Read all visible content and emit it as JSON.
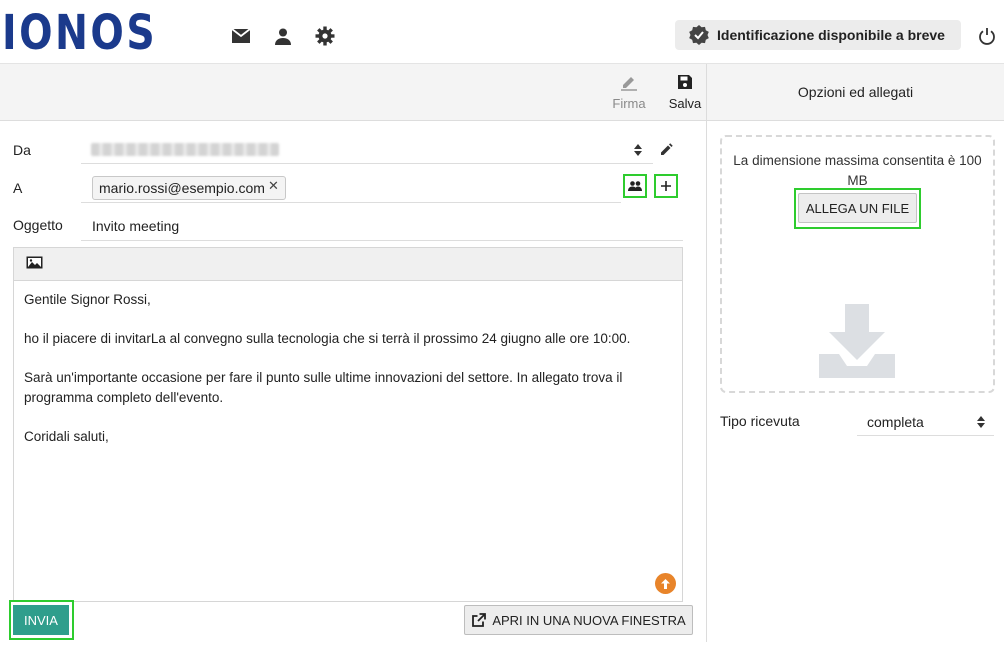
{
  "header": {
    "logo_text": "IONOS",
    "identification_label": "Identificazione disponibile a breve",
    "icons": [
      "mail-icon",
      "user-icon",
      "gear-icon",
      "verified-badge-icon",
      "power-icon"
    ]
  },
  "toolbar": {
    "signature_label": "Firma",
    "save_label": "Salva"
  },
  "options_panel": {
    "title": "Opzioni ed allegati",
    "max_size_text": "La dimensione massima consentita è 100 MB",
    "attach_button": "ALLEGA UN FILE",
    "receipt_label": "Tipo ricevuta",
    "receipt_value": "completa"
  },
  "form": {
    "from_label": "Da",
    "to_label": "A",
    "to_recipient": "mario.rossi@esempio.com",
    "subject_label": "Oggetto",
    "subject_value": "Invito meeting"
  },
  "message": {
    "greeting": "Gentile Signor Rossi,",
    "line1": "ho il piacere di invitarLa al convegno sulla tecnologia che si terrà il prossimo 24 giugno alle ore 10:00.",
    "line2": "Sarà un'importante occasione per fare il punto sulle ultime innovazioni del settore. In allegato trova il programma completo dell'evento.",
    "closing": "Coridali saluti,"
  },
  "actions": {
    "send_label": "INVIA",
    "new_window_label": "APRI IN UNA NUOVA FINESTRA"
  },
  "colors": {
    "brand": "#1b3a8c",
    "send_button": "#2f9e8c",
    "highlight": "#2ecc2e",
    "upload_badge": "#e8842a"
  }
}
